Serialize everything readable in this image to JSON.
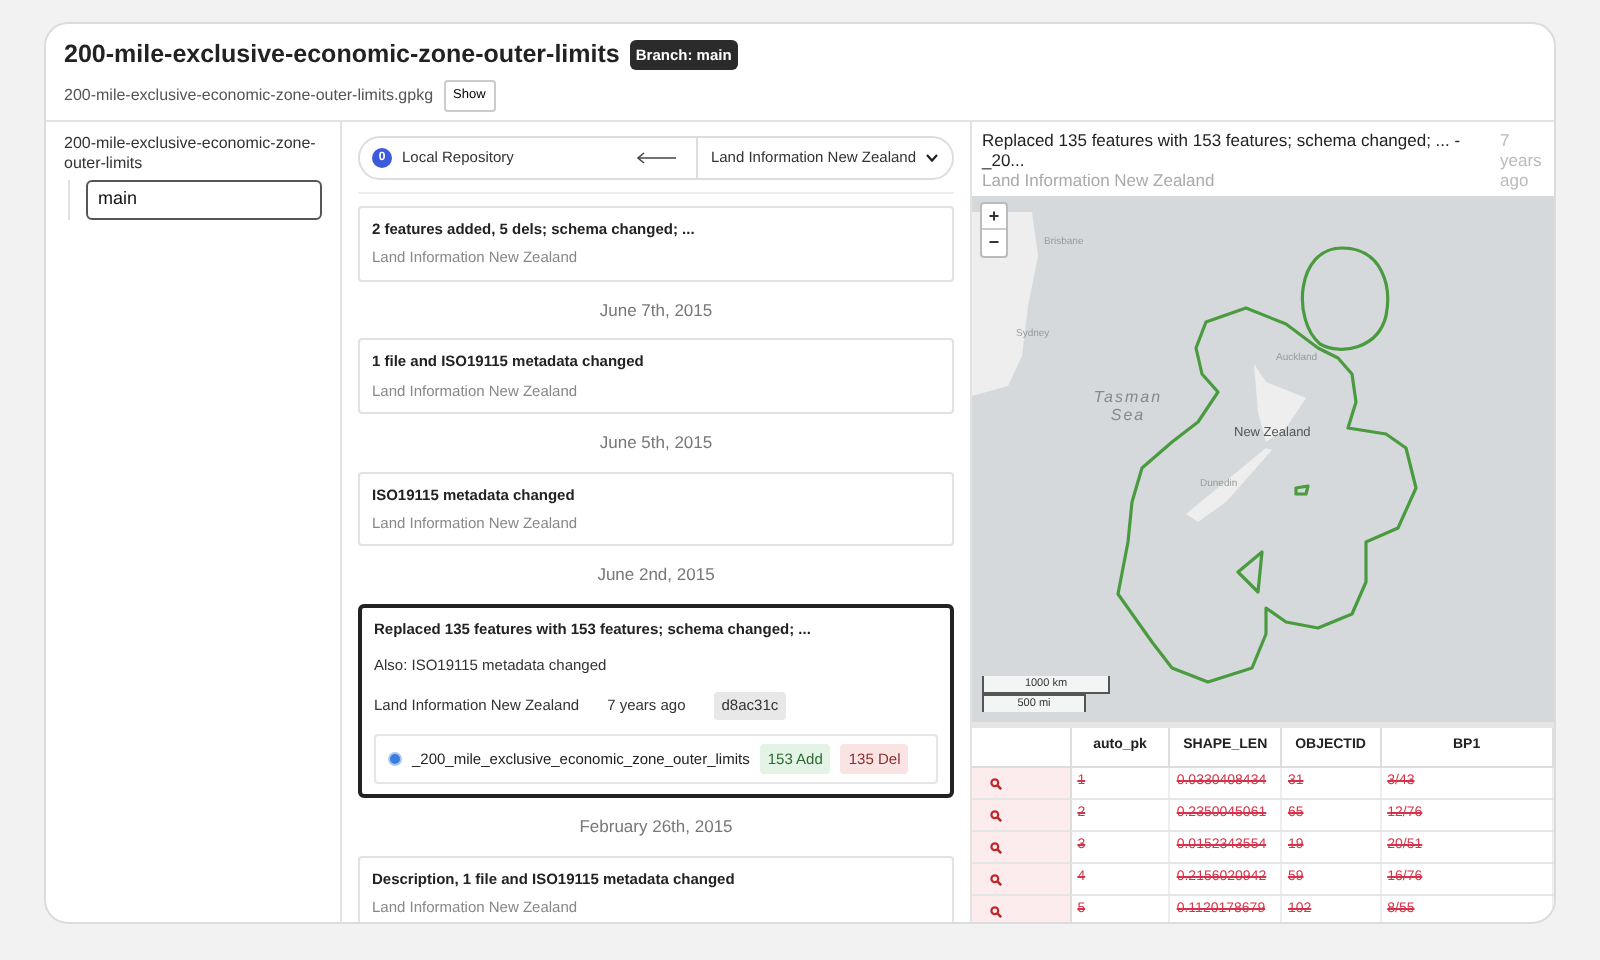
{
  "header": {
    "title": "200-mile-exclusive-economic-zone-outer-limits",
    "branch_badge": "Branch: main",
    "filename": "200-mile-exclusive-economic-zone-outer-limits.gpkg",
    "show_button": "Show"
  },
  "sidebar": {
    "repo_name": "200-mile-exclusive-economic-zone-outer-limits",
    "branches": [
      {
        "label": "main",
        "selected": true
      }
    ]
  },
  "remote_selector": {
    "badge": "0",
    "local": "Local Repository",
    "remote": "Land Information New Zealand"
  },
  "timeline": [
    {
      "kind": "commit",
      "title": "2 features added, 5 dels; schema changed; ...",
      "author": "Land Information New Zealand",
      "selected": false
    },
    {
      "kind": "date",
      "label": "June 7th, 2015"
    },
    {
      "kind": "commit",
      "title": "1 file and ISO19115 metadata changed",
      "author": "Land Information New Zealand",
      "selected": false
    },
    {
      "kind": "date",
      "label": "June 5th, 2015"
    },
    {
      "kind": "commit",
      "title": "ISO19115 metadata changed",
      "author": "Land Information New Zealand",
      "selected": false
    },
    {
      "kind": "date",
      "label": "June 2nd, 2015"
    },
    {
      "kind": "commit",
      "title": "Replaced 135 features with 153 features; schema changed; ...",
      "also": "Also: ISO19115 metadata changed",
      "author": "Land Information New Zealand",
      "time": "7 years ago",
      "hash": "d8ac31c",
      "layers": [
        {
          "name": "_200_mile_exclusive_economic_zone_outer_limits",
          "selected": true,
          "added": "153 Add",
          "deleted": "135 Del"
        }
      ],
      "selected": true
    },
    {
      "kind": "date",
      "label": "February 26th, 2015"
    },
    {
      "kind": "commit",
      "title": "Description, 1 file and ISO19115 metadata changed",
      "author": "Land Information New Zealand",
      "selected": false
    }
  ],
  "detail": {
    "title": "Replaced 135 features with 153 features; schema changed; ... - _20...",
    "author": "Land Information New Zealand",
    "time": "7 years ago"
  },
  "map": {
    "zoom_in": "+",
    "zoom_out": "−",
    "labels": [
      {
        "kind": "city",
        "text": "Brisbane"
      },
      {
        "kind": "city",
        "text": "Sydney"
      },
      {
        "kind": "sea",
        "text": "Tasman Sea"
      },
      {
        "kind": "city",
        "text": "Auckland"
      },
      {
        "kind": "country",
        "text": "New Zealand"
      },
      {
        "kind": "city",
        "text": "Dunedin"
      }
    ],
    "scale_km": "1000 km",
    "scale_mi": "500 mi"
  },
  "table": {
    "columns": [
      "auto_pk",
      "SHAPE_LEN",
      "OBJECTID",
      "BP1"
    ],
    "rows": [
      {
        "deleted": true,
        "cells": [
          "1",
          "0.0330408434",
          "31",
          "3/43"
        ]
      },
      {
        "deleted": true,
        "cells": [
          "2",
          "0.2350045061",
          "65",
          "12/76"
        ]
      },
      {
        "deleted": true,
        "cells": [
          "3",
          "0.0152343554",
          "19",
          "20/51"
        ]
      },
      {
        "deleted": true,
        "cells": [
          "4",
          "0.2156020942",
          "59",
          "16/76"
        ]
      },
      {
        "deleted": true,
        "cells": [
          "5",
          "0.1120178679",
          "102",
          "8/55"
        ]
      }
    ]
  }
}
